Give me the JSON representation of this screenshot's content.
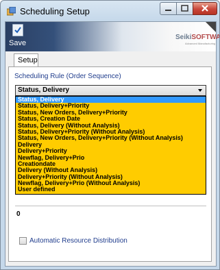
{
  "window": {
    "title": "Scheduling Setup",
    "app_icon": "app-icon",
    "controls": [
      "minimize-icon",
      "maximize-icon",
      "close-icon"
    ]
  },
  "toolbar": {
    "save_label": "Save",
    "save_icon": "save-icon",
    "logo_main": "Seiki",
    "logo_accent": "SOFTWARE",
    "logo_sub": "Advanced Manufacturing"
  },
  "tabs": [
    {
      "label": "Setup"
    }
  ],
  "setup": {
    "rule_label": "Scheduling Rule (Order Sequence)",
    "selected_rule": "Status, Delivery",
    "options": [
      "Status, Delivery",
      "Status, Delivery+Priority",
      "Status, New Orders, Delivery+Priority",
      "Status, Creation Date",
      "Status, Delivery (Without Analysis)",
      "Status, Delivery+Priority (Without Analysis)",
      "Status, New Orders, Delivery+Priority (Without Analysis)",
      "Delivery",
      "Delivery+Priority",
      "Newflag, Delivery+Prio",
      "Creationdate",
      "Delivery (Without Analysis)",
      "Delivery+Priority (Without Analysis)",
      "Newflag, Delivery+Prio (Without Analysis)",
      "User defined"
    ],
    "value": "0",
    "checkbox_label": "Automatic Resource Distribution",
    "checkbox_checked": false
  },
  "colors": {
    "dropdown_bg": "#ffcc00",
    "selection": "#3399ff",
    "label_blue": "#1f3c8c"
  }
}
